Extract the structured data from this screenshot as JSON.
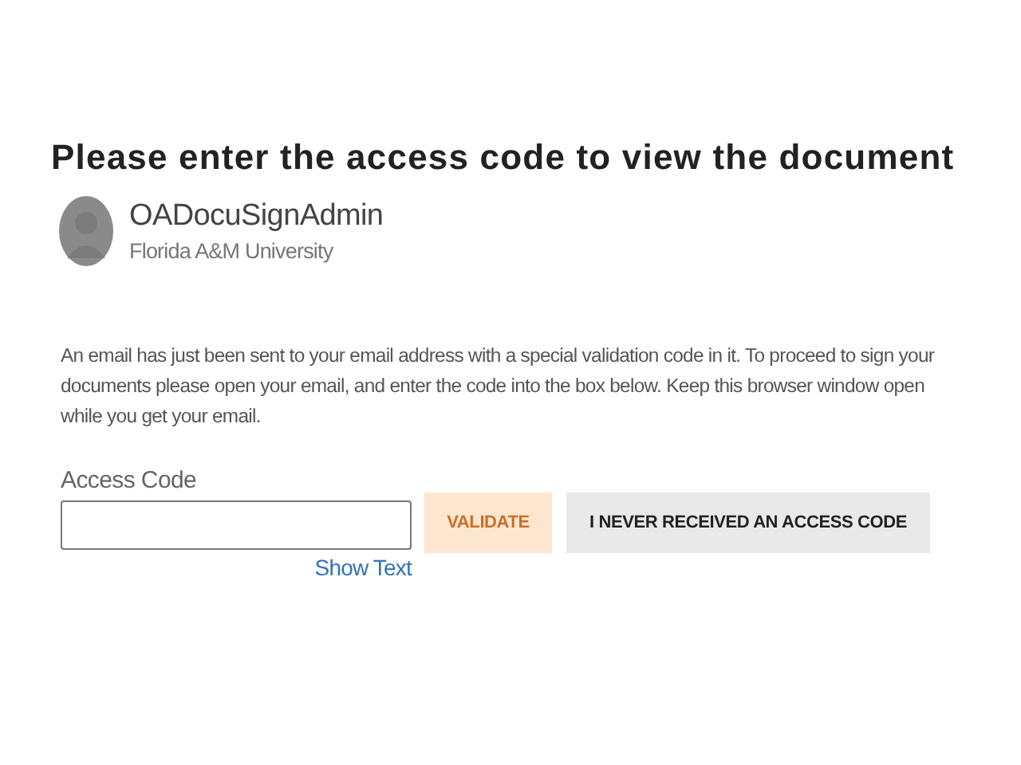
{
  "heading": "Please enter the access code to view the document",
  "sender": {
    "name": "OADocuSignAdmin",
    "organization": "Florida A&M University"
  },
  "message": "An email has just been sent to your email address with a special validation code in it. To proceed to sign your documents please open your email, and enter the code into the box below. Keep this browser window open while you get your email.",
  "access_code": {
    "label": "Access Code",
    "show_text_link": "Show Text"
  },
  "buttons": [
    {
      "label": "VALIDATE",
      "kind": "primary",
      "disabled": true
    },
    {
      "label": "I NEVER RECEIVED AN ACCESS CODE",
      "kind": "secondary",
      "disabled": false
    }
  ]
}
